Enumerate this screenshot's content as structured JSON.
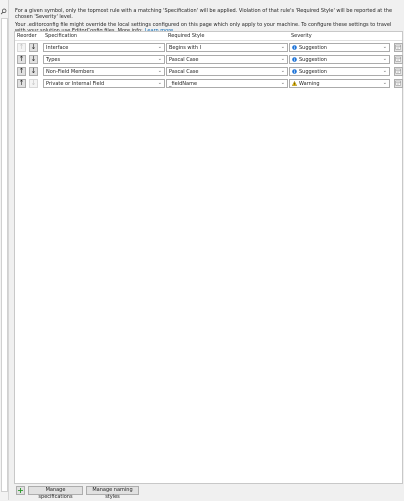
{
  "description": {
    "line1": "For a given symbol, only the topmost rule with a matching 'Specification' will be applied. Violation of that rule's 'Required Style' will be reported at the chosen 'Severity' level.",
    "line2": "Your .editorconfig file might override the local settings configured on this page which only apply to your machine. To configure these settings to travel with your solution use EditorConfig files. More info:",
    "learn_more": "Learn more"
  },
  "columns": {
    "reorder": "Reorder",
    "specification": "Specification",
    "required_style": "Required Style",
    "severity": "Severity"
  },
  "rows": [
    {
      "specification": "Interface",
      "required_style": "Begins with I",
      "severity": "Suggestion",
      "severity_kind": "info",
      "up_enabled": false,
      "down_enabled": true
    },
    {
      "specification": "Types",
      "required_style": "Pascal Case",
      "severity": "Suggestion",
      "severity_kind": "info",
      "up_enabled": true,
      "down_enabled": true
    },
    {
      "specification": "Non-Field Members",
      "required_style": "Pascal Case",
      "severity": "Suggestion",
      "severity_kind": "info",
      "up_enabled": true,
      "down_enabled": true
    },
    {
      "specification": "Private or Internal Field",
      "required_style": "_fieldName",
      "severity": "Warning",
      "severity_kind": "warning",
      "up_enabled": true,
      "down_enabled": false
    }
  ],
  "footer": {
    "add_label": "+",
    "manage_specifications": "Manage specifications",
    "manage_naming_styles": "Manage naming styles"
  },
  "icons": {
    "up": "arrow-up-icon",
    "down": "arrow-down-icon",
    "info": "info-circle-icon",
    "warning": "warning-triangle-icon",
    "configure": "configure-icon"
  },
  "colors": {
    "info": "#1e74d8",
    "warning": "#f0c000",
    "link": "#0063b1"
  }
}
